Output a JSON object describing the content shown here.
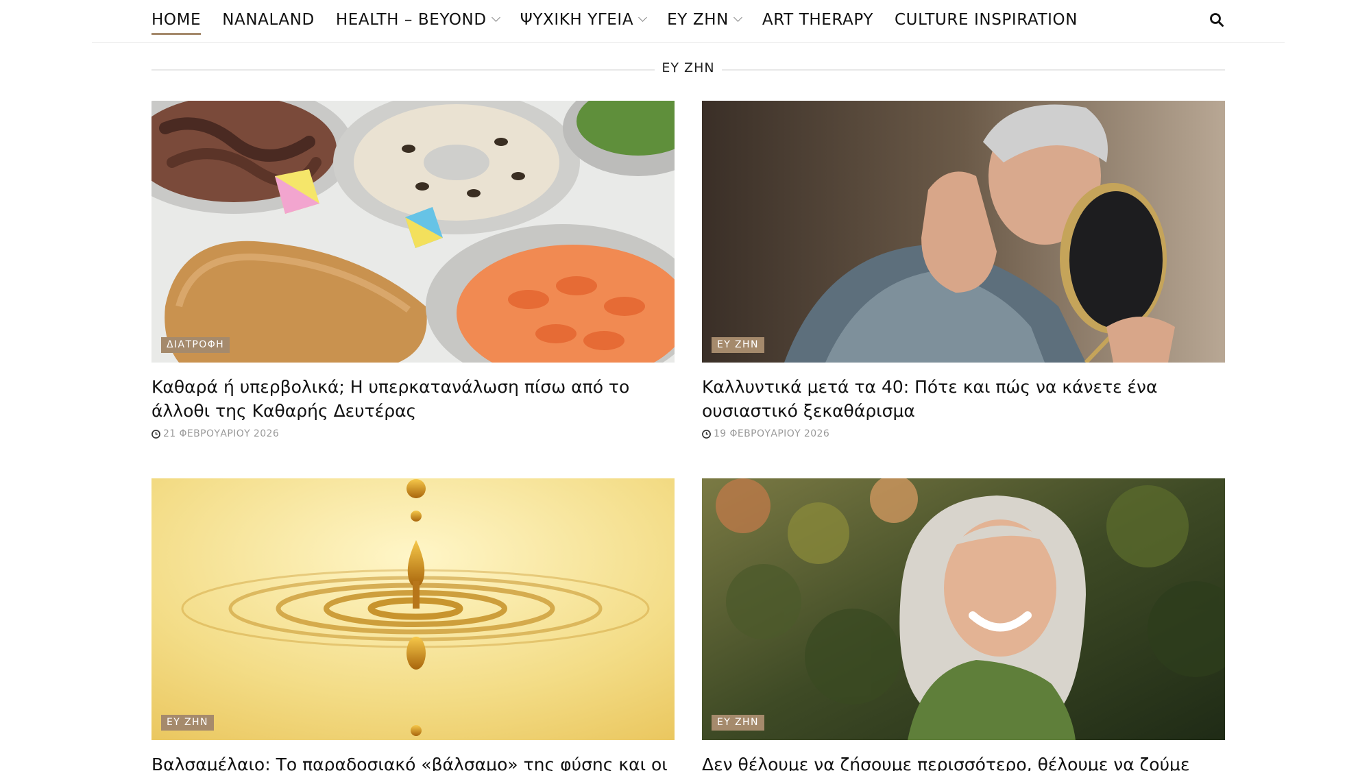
{
  "nav": {
    "items": [
      {
        "label": "HOME",
        "active": true
      },
      {
        "label": "NANALAND"
      },
      {
        "label": "HEALTH – BEYOND",
        "dropdown": true
      },
      {
        "label": "ΨΥΧΙΚΗ ΥΓΕΙΑ",
        "dropdown": true
      },
      {
        "label": "ΕΥ ΖΗΝ",
        "dropdown": true
      },
      {
        "label": "ART THERAPY"
      },
      {
        "label": "CULTURE INSPIRATION"
      }
    ],
    "search_icon": "search-icon"
  },
  "section": {
    "title": "ΕΥ ΖΗΝ"
  },
  "articles": [
    {
      "category": "ΔΙΑΤΡΟΦΗ",
      "title": "Καθαρά ή υπερβολικά; Η υπερκατανάλωση πίσω από το άλλοθι της Καθαρής Δευτέρας",
      "date": "21 ΦΕΒΡΟΥΑΡΙΟΥ 2026",
      "image": "clean-monday-food-photo"
    },
    {
      "category": "ΕΥ ΖΗΝ",
      "title": "Καλλυντικά μετά τα 40: Πότε και πώς να κάνετε ένα ουσιαστικό ξεκαθάρισμα",
      "date": "19 ΦΕΒΡΟΥΑΡΙΟΥ 2026",
      "image": "woman-mirror-skincare-photo"
    },
    {
      "category": "ΕΥ ΖΗΝ",
      "title": "Βαλσαμέλαιο: Το παραδοσιακό «βάλσαμο» της φύσης και οι",
      "date": "",
      "image": "oil-drop-photo"
    },
    {
      "category": "ΕΥ ΖΗΝ",
      "title": "Δεν θέλουμε να ζήσουμε περισσότερο, θέλουμε να ζούμε καλύτερα",
      "date": "",
      "image": "smiling-woman-garden-photo"
    }
  ],
  "colors": {
    "accent": "#a58a6c",
    "text": "#111111",
    "muted": "#999999",
    "divider": "#e6e6e6"
  }
}
